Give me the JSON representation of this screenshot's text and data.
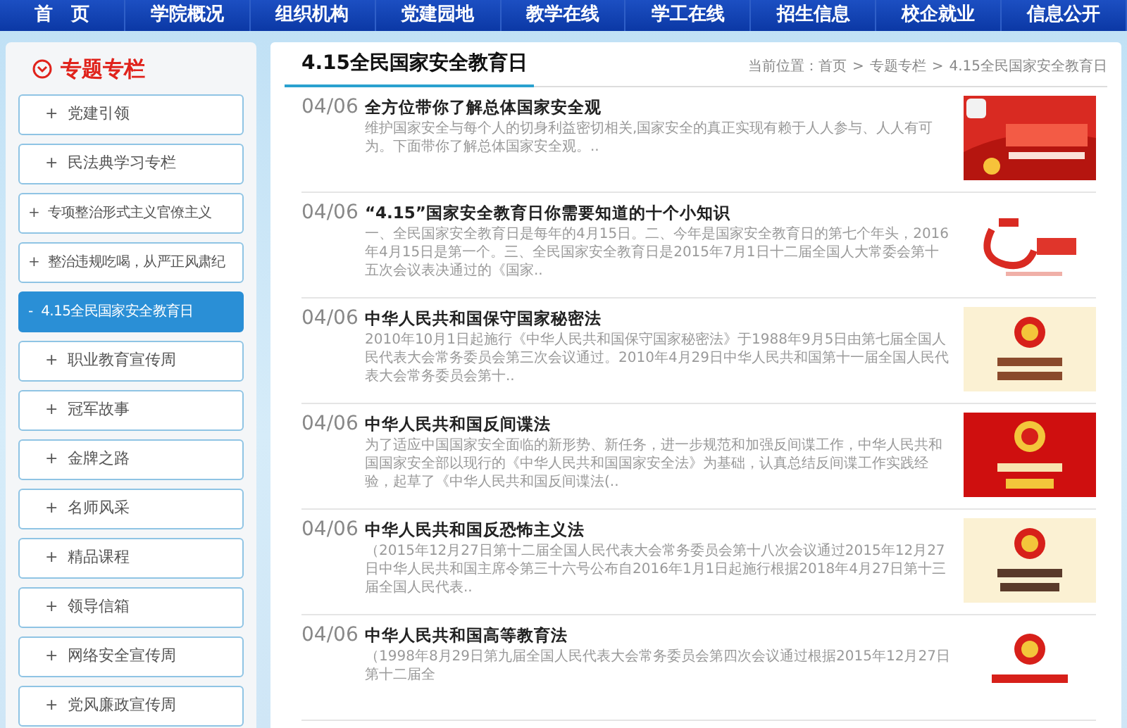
{
  "nav": [
    {
      "label": "首　页"
    },
    {
      "label": "学院概况"
    },
    {
      "label": "组织机构"
    },
    {
      "label": "党建园地"
    },
    {
      "label": "教学在线"
    },
    {
      "label": "学工在线"
    },
    {
      "label": "招生信息"
    },
    {
      "label": "校企就业"
    },
    {
      "label": "信息公开"
    }
  ],
  "sidebar": {
    "title": "专题专栏",
    "items": [
      {
        "marker": "+",
        "label": "党建引领",
        "selected": false
      },
      {
        "marker": "+",
        "label": "民法典学习专栏",
        "selected": false
      },
      {
        "marker": "+",
        "label": "专项整治形式主义官僚主义",
        "selected": false
      },
      {
        "marker": "+",
        "label": "整治违规吃喝，从严正风肃纪",
        "selected": false
      },
      {
        "marker": "-",
        "label": "4.15全民国家安全教育日",
        "selected": true
      },
      {
        "marker": "+",
        "label": "职业教育宣传周",
        "selected": false
      },
      {
        "marker": "+",
        "label": "冠军故事",
        "selected": false
      },
      {
        "marker": "+",
        "label": "金牌之路",
        "selected": false
      },
      {
        "marker": "+",
        "label": "名师风采",
        "selected": false
      },
      {
        "marker": "+",
        "label": "精品课程",
        "selected": false
      },
      {
        "marker": "+",
        "label": "领导信箱",
        "selected": false
      },
      {
        "marker": "+",
        "label": "网络安全宣传周",
        "selected": false
      },
      {
        "marker": "+",
        "label": "党风廉政宣传周",
        "selected": false
      }
    ]
  },
  "main": {
    "title": "4.15全民国家安全教育日",
    "breadcrumb": [
      {
        "kind": "label",
        "text": "当前位置："
      },
      {
        "kind": "link",
        "text": "首页"
      },
      {
        "kind": "separator",
        "text": ">"
      },
      {
        "kind": "link",
        "text": "专题专栏"
      },
      {
        "kind": "separator",
        "text": ">"
      },
      {
        "kind": "link",
        "text": "4.15全民国家安全教育日"
      }
    ],
    "articles": [
      {
        "date": "04/06",
        "title": "全方位带你了解总体国家安全观",
        "summary": "维护国家安全与每个人的切身利益密切相关,国家安全的真正实现有赖于人人参与、人人有可为。下面带你了解总体国家安全观。.."
      },
      {
        "date": "04/06",
        "title": "“4.15”国家安全教育日你需要知道的十个小知识",
        "summary": "一、全民国家安全教育日是每年的4月15日。二、今年是国家安全教育日的第七个年头，2016年4月15日是第一个。三、全民国家安全教育日是2015年7月1日十二届全国人大常委会第十五次会议表决通过的《国家.."
      },
      {
        "date": "04/06",
        "title": "中华人民共和国保守国家秘密法",
        "summary": "2010年10月1日起施行《中华人民共和国保守国家秘密法》于1988年9月5日由第七届全国人民代表大会常务委员会第三次会议通过。2010年4月29日中华人民共和国第十一届全国人民代表大会常务委员会第十.."
      },
      {
        "date": "04/06",
        "title": "中华人民共和国反间谍法",
        "summary": " 为了适应中国国家安全面临的新形势、新任务，进一步规范和加强反间谍工作，中华人民共和国国家安全部以现行的《中华人民共和国国家安全法》为基础，认真总结反间谍工作实践经验，起草了《中华人民共和国反间谍法(.."
      },
      {
        "date": "04/06",
        "title": "中华人民共和国反恐怖主义法",
        "summary": "（2015年12月27日第十二届全国人民代表大会常务委员会第十八次会议通过2015年12月27日中华人民共和国主席令第三十六号公布自2016年1月1日起施行根据2018年4月27日第十三届全国人民代表.."
      },
      {
        "date": "04/06",
        "title": "中华人民共和国高等教育法",
        "summary": "（1998年8月29日第九届全国人民代表大会常务委员会第四次会议通过根据2015年12月27日第十二届全"
      }
    ]
  }
}
